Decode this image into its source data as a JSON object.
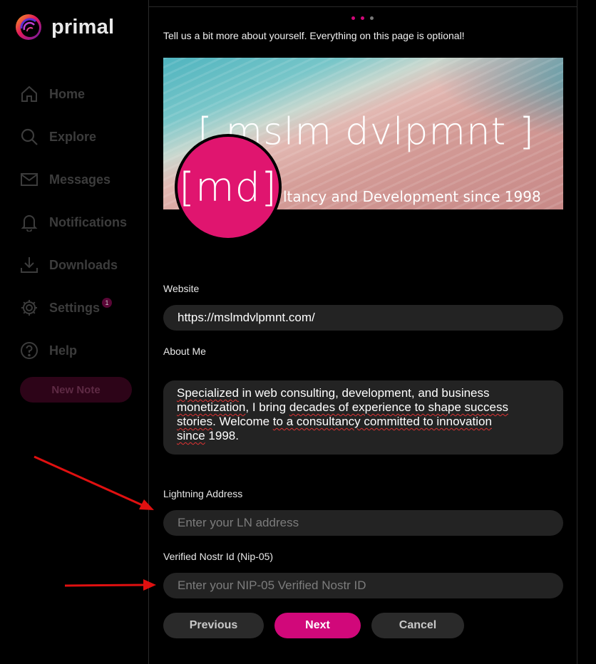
{
  "app": {
    "name": "primal"
  },
  "sidebar": {
    "items": [
      {
        "label": "Home",
        "icon": "home-icon"
      },
      {
        "label": "Explore",
        "icon": "search-icon"
      },
      {
        "label": "Messages",
        "icon": "envelope-icon"
      },
      {
        "label": "Notifications",
        "icon": "bell-icon"
      },
      {
        "label": "Downloads",
        "icon": "download-icon"
      },
      {
        "label": "Settings",
        "icon": "gear-icon",
        "badge": "1"
      },
      {
        "label": "Help",
        "icon": "help-icon"
      }
    ],
    "new_note_label": "New Note"
  },
  "wizard": {
    "step_dots": [
      "#d1087a",
      "#d1087a",
      "#777777"
    ],
    "intro": "Tell us a bit more about yourself. Everything on this page is optional!",
    "banner": {
      "title": "[ mslm dvlpmnt ]",
      "subtitle": "ltancy and Development since 1998"
    },
    "avatar_text": "[md]",
    "website": {
      "label": "Website",
      "value": "https://mslmdvlpmnt.com/"
    },
    "about": {
      "label": "About Me",
      "line1_a": "Specialized",
      "line1_b": " in web consulting, development, and business",
      "line2_a": "monetization",
      "line2_b": ", I bring ",
      "line2_c": "decades of experience to shape success",
      "line3_a": "stories",
      "line3_b": ". Welcome ",
      "line3_c": "to a consultancy committed to innovation",
      "line4_a": "since",
      "line4_b": " 1998."
    },
    "lightning": {
      "label": "Lightning Address",
      "placeholder": "Enter your LN address"
    },
    "nip05": {
      "label": "Verified Nostr Id (Nip-05)",
      "placeholder": "Enter your NIP-05 Verified Nostr ID"
    },
    "buttons": {
      "previous": "Previous",
      "next": "Next",
      "cancel": "Cancel"
    }
  },
  "colors": {
    "accent": "#d1087a",
    "annotation_arrow": "#e01010"
  }
}
